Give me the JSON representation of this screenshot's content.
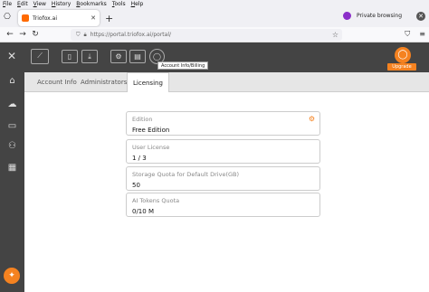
{
  "menu": [
    "File",
    "Edit",
    "View",
    "History",
    "Bookmarks",
    "Tools",
    "Help"
  ],
  "browser": {
    "tab_title": "Triofox.ai",
    "url": "https://portal.triofox.ai/portal/",
    "private_label": "Private browsing"
  },
  "header": {
    "tooltip": "Account Info/Billing",
    "upgrade_label": "Upgrade"
  },
  "tabs": [
    "Account Info",
    "Administrators",
    "Licensing"
  ],
  "active_tab": "Licensing",
  "fields": [
    {
      "label": "Edition",
      "value": "Free Edition"
    },
    {
      "label": "User License",
      "value": "1 / 3"
    },
    {
      "label": "Storage Quota for Default Drive(GB)",
      "value": "50"
    },
    {
      "label": "AI Tokens Quota",
      "value": "0/10 M"
    }
  ],
  "colors": {
    "accent": "#f58220",
    "header_bg": "#444444",
    "private": "#8b2fc9"
  }
}
